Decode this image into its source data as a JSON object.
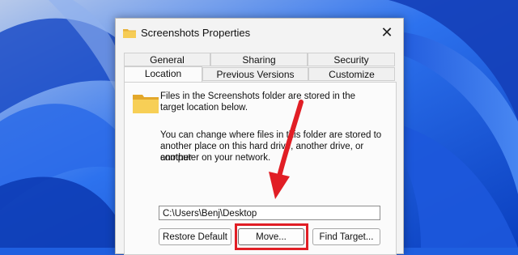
{
  "window": {
    "title": "Screenshots Properties",
    "close_symbol": "✕"
  },
  "tabs": {
    "row_top": [
      "General",
      "Sharing",
      "Security"
    ],
    "row_bottom": [
      "Location",
      "Previous Versions",
      "Customize"
    ],
    "active": "Location"
  },
  "location_panel": {
    "intro_line1": "Files in the Screenshots folder are stored in the",
    "intro_line2": "target location below.",
    "desc_line1": "You can change where files in this folder are stored to",
    "desc_line2": "another place on this hard drive, another drive, or another",
    "desc_line3": "computer on your network.",
    "path_value": "C:\\Users\\Benj\\Desktop",
    "restore_default_label": "Restore Default",
    "move_label": "Move...",
    "find_target_label": "Find Target..."
  },
  "annotation": {
    "highlight_color": "#e11e25"
  }
}
